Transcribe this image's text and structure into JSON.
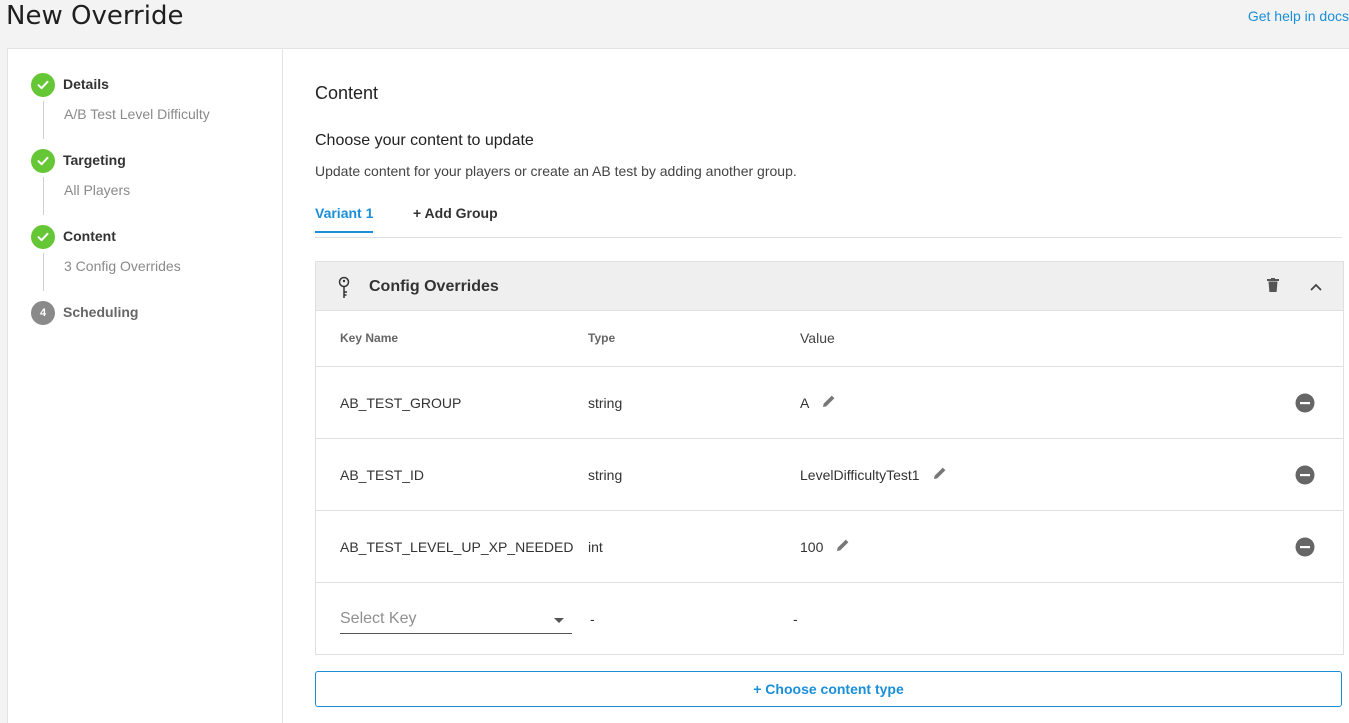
{
  "header": {
    "title": "New Override",
    "help_link": "Get help in docs"
  },
  "steps": [
    {
      "title": "Details",
      "subtitle": "A/B Test Level Difficulty",
      "status": "complete",
      "icon": "check-icon"
    },
    {
      "title": "Targeting",
      "subtitle": "All Players",
      "status": "complete",
      "icon": "check-icon"
    },
    {
      "title": "Content",
      "subtitle": "3 Config Overrides",
      "status": "complete",
      "icon": "check-icon"
    },
    {
      "title": "Scheduling",
      "subtitle": "",
      "status": "pending",
      "number": "4"
    }
  ],
  "content": {
    "section_title": "Content",
    "choose_title": "Choose your content to update",
    "choose_desc": "Update content for your players or create an AB test by adding another group.",
    "tabs": [
      {
        "label": "Variant 1",
        "active": true
      },
      {
        "label": "+ Add Group",
        "active": false
      }
    ],
    "card": {
      "title": "Config Overrides",
      "columns": {
        "key": "Key Name",
        "type": "Type",
        "value": "Value"
      },
      "rows": [
        {
          "key": "AB_TEST_GROUP",
          "type": "string",
          "value": "A"
        },
        {
          "key": "AB_TEST_ID",
          "type": "string",
          "value": "LevelDifficultyTest1"
        },
        {
          "key": "AB_TEST_LEVEL_UP_XP_NEEDED",
          "type": "int",
          "value": "100"
        }
      ],
      "new_row": {
        "placeholder": "Select Key",
        "type": "-",
        "value": "-"
      }
    },
    "choose_button": "+ Choose content type"
  },
  "colors": {
    "accent": "#1a8fd8",
    "complete": "#65c735",
    "pending": "#8a8a8a"
  }
}
